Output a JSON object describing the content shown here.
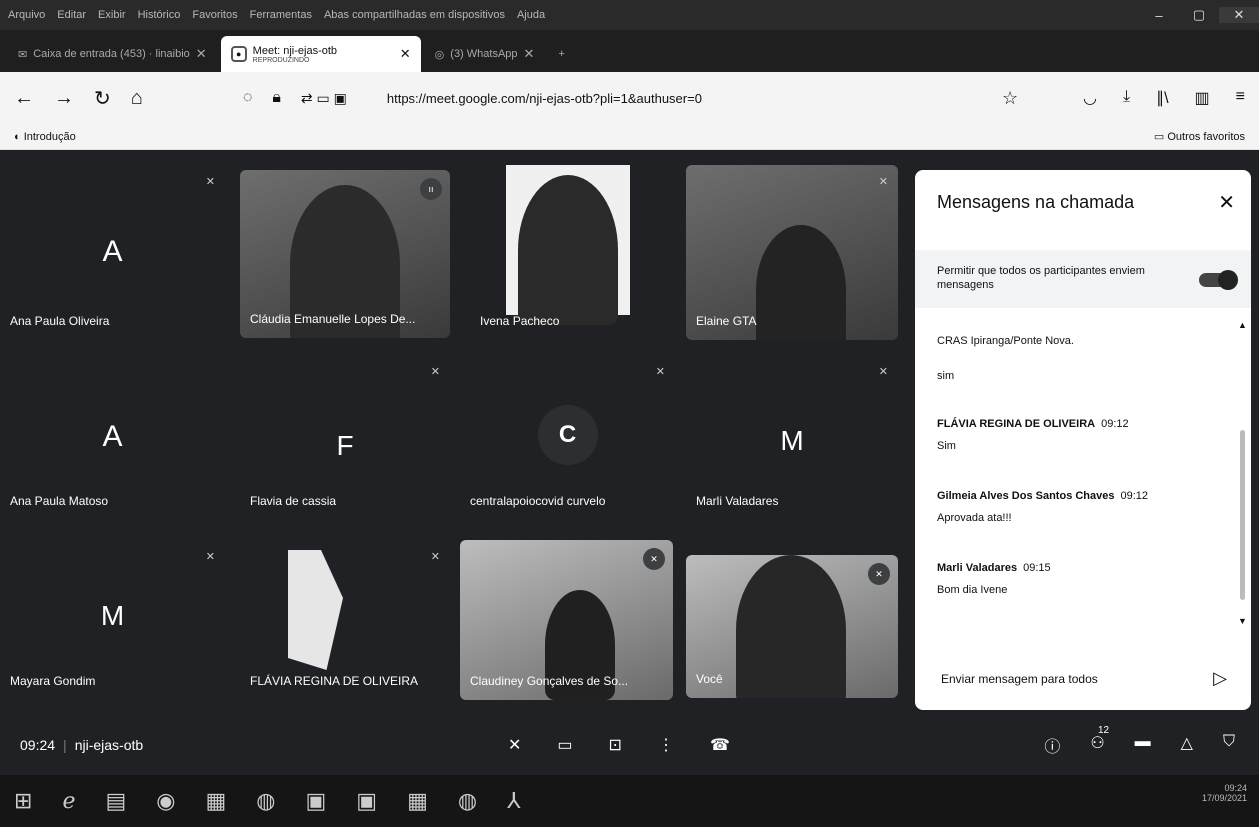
{
  "menu": [
    "Arquivo",
    "Editar",
    "Exibir",
    "Histórico",
    "Favoritos",
    "Ferramentas",
    "Abas compartilhadas em dispositivos",
    "Ajuda"
  ],
  "tabs": [
    {
      "label": "Caixa de entrada (453) · linaibio",
      "active": false
    },
    {
      "label": "Meet: nji-ejas-otb",
      "sub": "REPRODUZINDO",
      "active": true
    },
    {
      "label": "(3) WhatsApp",
      "active": false
    }
  ],
  "nav": {
    "url": "https://meet.google.com/nji-ejas-otb?pli=1&authuser=0"
  },
  "bookmarks": {
    "left": "Introdução",
    "right": "Outros favoritos"
  },
  "tiles": [
    {
      "name": "Ana Paula Oliveira",
      "letter": "A"
    },
    {
      "name": "Cláudia Emanuelle Lopes De..."
    },
    {
      "name": "Ivena Pacheco"
    },
    {
      "name": "Elaine GTA"
    },
    {
      "name": "Ana Paula Matoso",
      "letter": "A"
    },
    {
      "name": "Flavia de cassia",
      "letter": "F"
    },
    {
      "name": "centralapoiocovid curvelo",
      "letter": "C"
    },
    {
      "name": "Marli Valadares",
      "letter": "M"
    },
    {
      "name": "Mayara Gondim",
      "letter": "M"
    },
    {
      "name": "FLÁVIA REGINA DE OLIVEIRA"
    },
    {
      "name": "Claudiney Gonçalves de So..."
    },
    {
      "name": "Você"
    }
  ],
  "chat": {
    "title": "Mensagens na chamada",
    "allow": "Permitir que todos os participantes enviem mensagens",
    "messages": [
      {
        "who": "",
        "time": "",
        "text": "CRAS Ipiranga/Ponte Nova."
      },
      {
        "who": "",
        "time": "",
        "text": "sim"
      },
      {
        "who": "FLÁVIA REGINA DE OLIVEIRA",
        "time": "09:12",
        "text": "Sim"
      },
      {
        "who": "Gilmeia Alves Dos Santos Chaves",
        "time": "09:12",
        "text": "Aprovada ata!!!"
      },
      {
        "who": "Marli Valadares",
        "time": "09:15",
        "text": "Bom dia Ivene"
      }
    ],
    "placeholder": "Enviar mensagem para todos"
  },
  "bottom": {
    "time": "09:24",
    "code": "nji-ejas-otb",
    "participants": "12"
  },
  "taskbar": {
    "time": "09:24",
    "date": "17/09/2021"
  }
}
